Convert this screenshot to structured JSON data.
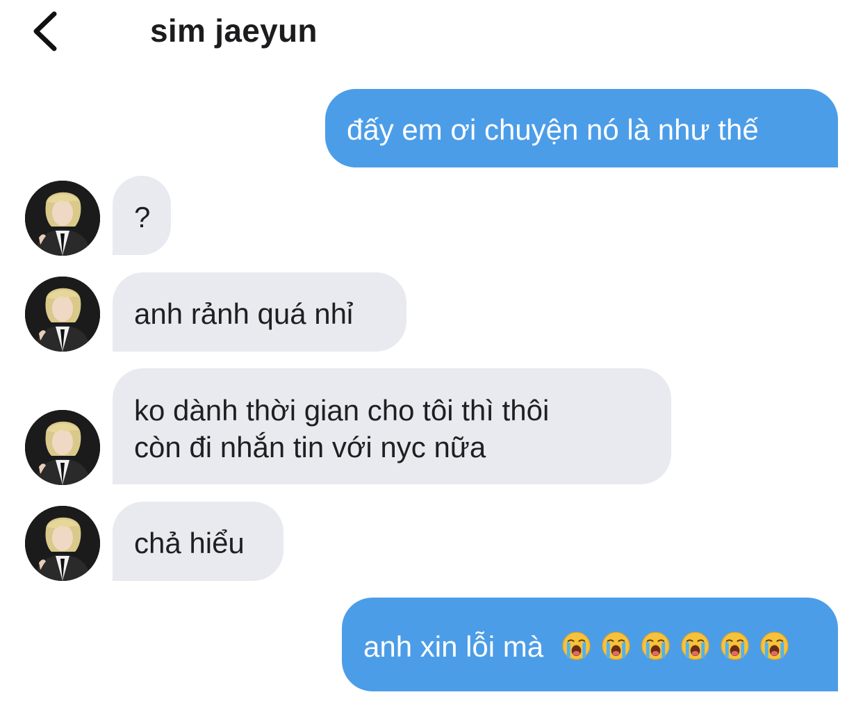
{
  "header": {
    "back_icon": "chevron-left-icon",
    "title": "sim jaeyun"
  },
  "messages": [
    {
      "direction": "outgoing",
      "text": "đấy em ơi chuyện nó là như thế"
    },
    {
      "direction": "incoming",
      "text": "?"
    },
    {
      "direction": "incoming",
      "text": "anh rảnh quá nhỉ"
    },
    {
      "direction": "incoming",
      "lines": [
        "ko dành thời gian cho tôi thì thôi",
        "còn đi nhắn tin với nyc nữa"
      ]
    },
    {
      "direction": "incoming",
      "text": "chả hiểu"
    },
    {
      "direction": "outgoing",
      "text": "anh xin lỗi mà",
      "emoji": [
        "loudly-crying-face-icon",
        "loudly-crying-face-icon",
        "loudly-crying-face-icon",
        "loudly-crying-face-icon",
        "loudly-crying-face-icon",
        "loudly-crying-face-icon"
      ]
    }
  ],
  "colors": {
    "outgoing_bubble": "#4c9de8",
    "incoming_bubble": "#e8eaef",
    "background": "#ffffff",
    "title_text": "#1c1c1e"
  },
  "avatar_icon": "profile-photo"
}
